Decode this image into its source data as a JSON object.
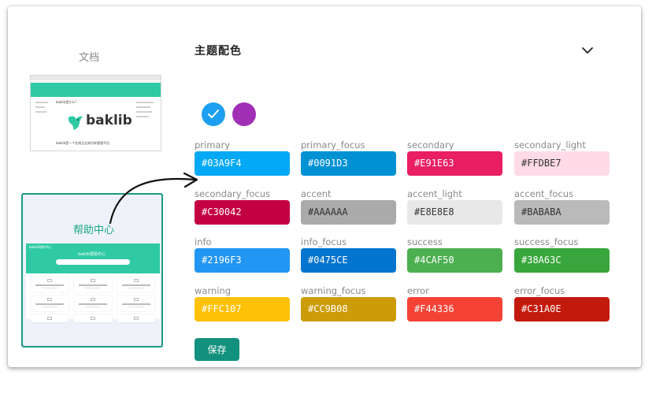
{
  "templates": {
    "doc_label": "文档",
    "help_label": "帮助中心",
    "doc_thumb": {
      "title": "baklib是什么?",
      "logo": "baklib",
      "footer": "baklib是一个在线企业知识库管理平台"
    },
    "help_thumb": {
      "brand": "baklib帮助中心",
      "banner_title": "baklib帮助中心"
    }
  },
  "theme": {
    "title": "主题配色",
    "swatches": [
      {
        "name": "blue",
        "color": "#1C9FF0",
        "selected": true
      },
      {
        "name": "purple",
        "color": "#A02FB5",
        "selected": false
      }
    ],
    "fields": [
      {
        "label": "primary",
        "value": "#03A9F4",
        "bg": "#03A9F4",
        "fg": "#ffffff"
      },
      {
        "label": "primary_focus",
        "value": "#0091D3",
        "bg": "#0091D3",
        "fg": "#ffffff"
      },
      {
        "label": "secondary",
        "value": "#E91E63",
        "bg": "#E91E63",
        "fg": "#ffffff"
      },
      {
        "label": "secondary_light",
        "value": "#FFDBE7",
        "bg": "#FFDBE7",
        "fg": "#333333"
      },
      {
        "label": "secondary_focus",
        "value": "#C30042",
        "bg": "#C30042",
        "fg": "#ffffff"
      },
      {
        "label": "accent",
        "value": "#AAAAAA",
        "bg": "#AAAAAA",
        "fg": "#333333"
      },
      {
        "label": "accent_light",
        "value": "#E8E8E8",
        "bg": "#E8E8E8",
        "fg": "#333333"
      },
      {
        "label": "accent_focus",
        "value": "#BABABA",
        "bg": "#BABABA",
        "fg": "#333333"
      },
      {
        "label": "info",
        "value": "#2196F3",
        "bg": "#2196F3",
        "fg": "#ffffff"
      },
      {
        "label": "info_focus",
        "value": "#0475CE",
        "bg": "#0475CE",
        "fg": "#ffffff"
      },
      {
        "label": "success",
        "value": "#4CAF50",
        "bg": "#4CAF50",
        "fg": "#ffffff"
      },
      {
        "label": "success_focus",
        "value": "#38A63C",
        "bg": "#38A63C",
        "fg": "#ffffff"
      },
      {
        "label": "warning",
        "value": "#FFC107",
        "bg": "#FFC107",
        "fg": "#ffffff"
      },
      {
        "label": "warning_focus",
        "value": "#CC9B08",
        "bg": "#CC9B08",
        "fg": "#ffffff"
      },
      {
        "label": "error",
        "value": "#F44336",
        "bg": "#F44336",
        "fg": "#ffffff"
      },
      {
        "label": "error_focus",
        "value": "#C31A0E",
        "bg": "#C31A0E",
        "fg": "#ffffff"
      }
    ],
    "save_label": "保存"
  }
}
